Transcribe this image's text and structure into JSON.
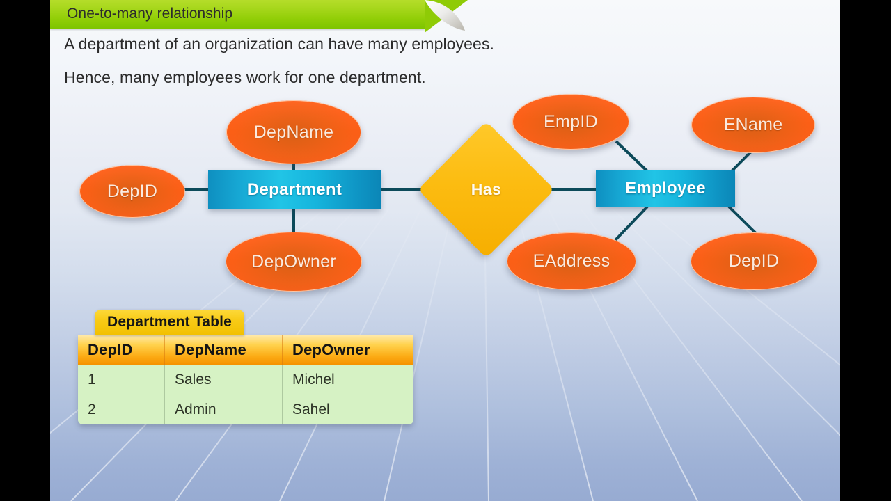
{
  "slide": {
    "title": "One-to-many relationship",
    "paragraph_line_1": "A department of an organization can have many employees.",
    "paragraph_line_2": "Hence, many employees work for one department."
  },
  "colors": {
    "title_bar_green_light": "#b5dd2a",
    "title_bar_green_dark": "#7cc400",
    "attribute_orange": "#fb5f16",
    "entity_cyan": "#21c4e6",
    "entity_teal": "#0b86b7",
    "relationship_gold": "#fcbc11",
    "table_title_gold": "#f8cb17",
    "table_header_orange": "#fcab14",
    "table_cell_green": "#d6f2c4",
    "connector_line": "#0c4a5a",
    "background_top": "#f7f9fb",
    "background_bottom": "#97abd2"
  },
  "er_diagram": {
    "entities": [
      {
        "id": "department",
        "label": "Department"
      },
      {
        "id": "employee",
        "label": "Employee"
      }
    ],
    "relationship": {
      "id": "has",
      "label": "Has",
      "shape": "diamond",
      "cardinality": "one-to-many"
    },
    "department_attributes": [
      {
        "label": "DepName",
        "position": "top"
      },
      {
        "label": "DepID",
        "position": "left"
      },
      {
        "label": "DepOwner",
        "position": "bottom"
      }
    ],
    "employee_attributes": [
      {
        "label": "EmpID",
        "position": "top-left"
      },
      {
        "label": "EName",
        "position": "top-right"
      },
      {
        "label": "EAddress",
        "position": "bottom-left"
      },
      {
        "label": "DepID",
        "position": "bottom-right"
      }
    ]
  },
  "department_table": {
    "title": "Department Table",
    "columns": [
      "DepID",
      "DepName",
      "DepOwner"
    ],
    "rows": [
      [
        "1",
        "Sales",
        "Michel"
      ],
      [
        "2",
        "Admin",
        "Sahel"
      ]
    ]
  }
}
